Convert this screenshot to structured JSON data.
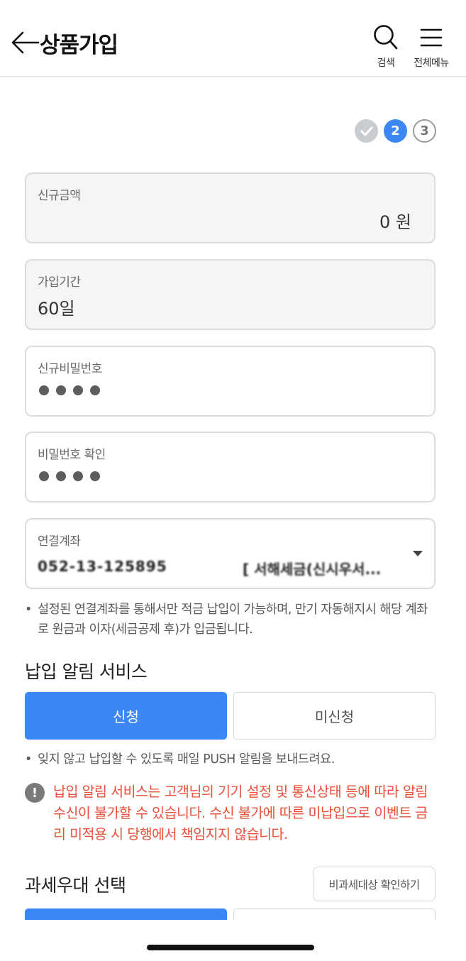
{
  "header": {
    "title": "상품가입",
    "search_label": "검색",
    "menu_label": "전체메뉴"
  },
  "steps": [
    {
      "state": "done",
      "label": ""
    },
    {
      "state": "active",
      "label": "2"
    },
    {
      "state": "todo",
      "label": "3"
    }
  ],
  "form": {
    "amount": {
      "label": "신규금액",
      "value": "0 원"
    },
    "period": {
      "label": "가입기간",
      "value": "60일"
    },
    "password": {
      "label": "신규비밀번호"
    },
    "password_confirm": {
      "label": "비밀번호 확인"
    },
    "linked_account": {
      "label": "연결계좌",
      "number": "052-13-125895",
      "name": "[ 서해세금(신시우서..."
    }
  },
  "notes": {
    "linked_account_note": "설정된 연결계좌를 통해서만 적금 납입이 가능하며, 만기 자동해지시 해당 계좌로 원금과 이자(세금공제 후)가 입금됩니다.",
    "push_note": "잊지 않고 납입할 수 있도록 매일 PUSH 알림을 보내드려요."
  },
  "payment_alert": {
    "title": "납입 알림 서비스",
    "apply_label": "신청",
    "not_apply_label": "미신청",
    "selected": "신청",
    "warning_icon": "!",
    "warning": "납입 알림 서비스는 고객님의 기기 설정 및 통신상태 등에 따라 알림 수신이 불가할 수 있습니다. 수신 불가에 따른 미납입으로 이벤트 금리 미적용 시 당행에서 책임지지 않습니다."
  },
  "tax": {
    "title": "과세우대 선택",
    "check_label": "비과세대상 확인하기"
  },
  "colors": {
    "accent": "#3d87f5",
    "warning": "#e8503a"
  }
}
